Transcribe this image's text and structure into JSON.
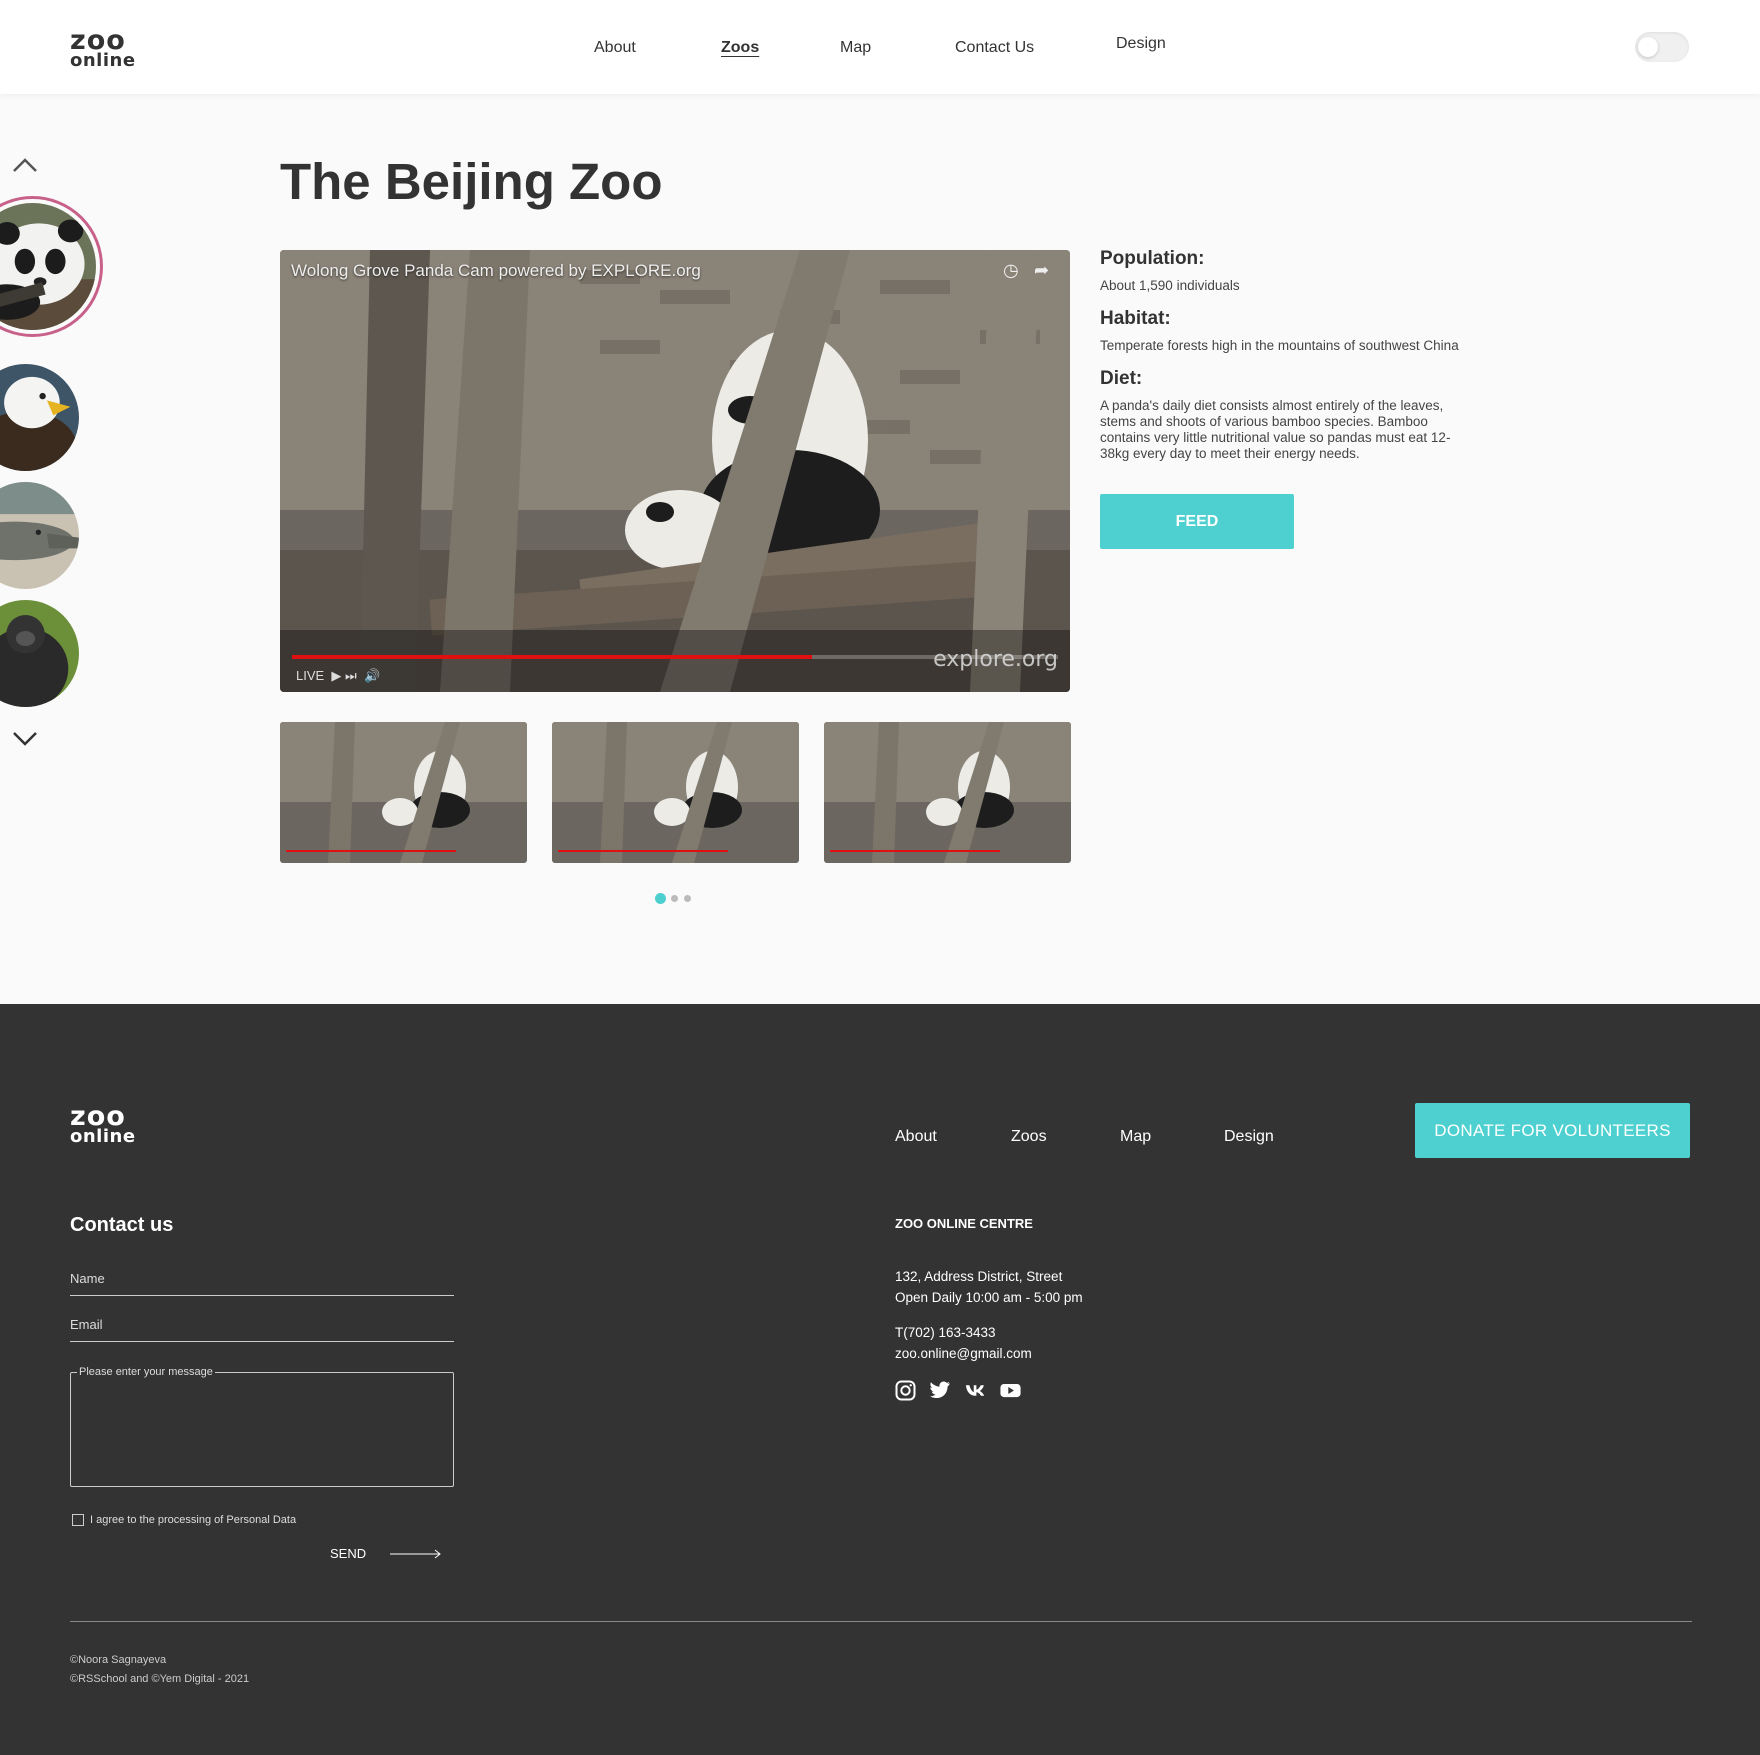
{
  "header": {
    "logo_line1": "zoo",
    "logo_line2": "online",
    "nav": [
      {
        "label": "About"
      },
      {
        "label": "Zoos",
        "active": true
      },
      {
        "label": "Map"
      },
      {
        "label": "Contact Us"
      },
      {
        "label": "Design"
      }
    ]
  },
  "main": {
    "title": "The Beijing Zoo",
    "video": {
      "title": "Wolong Grove Panda Cam powered by EXPLORE.org",
      "live_label": "LIVE",
      "brand": "explore.org"
    },
    "info": {
      "population_label": "Population:",
      "population_value": "About 1,590 individuals",
      "habitat_label": "Habitat:",
      "habitat_value": "Temperate forests high in the mountains of southwest China",
      "diet_label": "Diet:",
      "diet_value": "A panda's daily diet consists almost entirely of the leaves, stems and shoots of various bamboo species. Bamboo contains very little nutritional value so pandas must eat 12-38kg every day to meet their energy needs."
    },
    "feed_label": "FEED",
    "side_animals": [
      "panda",
      "eagle",
      "alligator",
      "gorilla"
    ],
    "carousel_active_dot": 1,
    "carousel_dots": 3
  },
  "footer": {
    "logo_line1": "zoo",
    "logo_line2": "online",
    "nav": [
      {
        "label": "About"
      },
      {
        "label": "Zoos"
      },
      {
        "label": "Map"
      },
      {
        "label": "Design"
      }
    ],
    "donate_label": "DONATE FOR VOLUNTEERS",
    "contact_title": "Contact us",
    "name_placeholder": "Name",
    "email_placeholder": "Email",
    "message_placeholder": "Please enter your message",
    "agree_label": "I agree to the processing of Personal Data",
    "send_label": "SEND",
    "centre_title": "ZOO ONLINE CENTRE",
    "address_line1": "132, Address District, Street",
    "address_line2": "Open Daily 10:00 am - 5:00 pm",
    "phone": "T(702) 163-3433",
    "email": "zoo.online@gmail.com",
    "social_icons": [
      "instagram-icon",
      "twitter-icon",
      "vk-icon",
      "youtube-icon"
    ],
    "copyright1": "©Noora Sagnayeva",
    "copyright2": "©RSSchool and ©Yem Digital - 2021"
  },
  "colors": {
    "accent": "#4dd0cf",
    "footer_bg": "#333333",
    "page_bg": "#fafafa",
    "progress": "#e01010"
  }
}
